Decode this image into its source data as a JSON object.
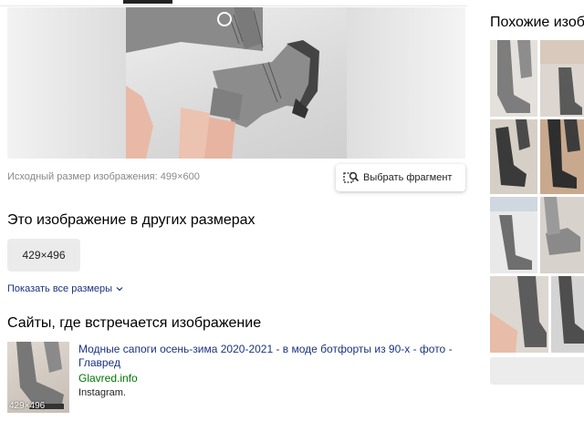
{
  "preview": {
    "original_size_text": "Исходный размер изображения: 499×600",
    "fragment_button_label": "Выбрать фрагмент"
  },
  "sizes": {
    "heading": "Это изображение в других размерах",
    "chip_label": "429×496",
    "show_all_label": "Показать все размеры"
  },
  "sites": {
    "heading": "Сайты, где встречается изображение",
    "results": [
      {
        "title": "Модные сапоги осень-зима 2020-2021 - в моде ботфорты из 90-х - фото - Главред",
        "domain": "Glavred.info",
        "description": "Instagram.",
        "thumb_badge": "429×496"
      }
    ]
  },
  "similar": {
    "heading": "Похожие изоб"
  },
  "icons": {
    "fragment": "crop-fragment-icon",
    "chevron": "chevron-down-icon",
    "carousel": "carousel-dot-icon"
  },
  "colors": {
    "link": "#1a3380",
    "domain": "#007700",
    "muted": "#888888",
    "chip_bg": "#ebebeb"
  }
}
